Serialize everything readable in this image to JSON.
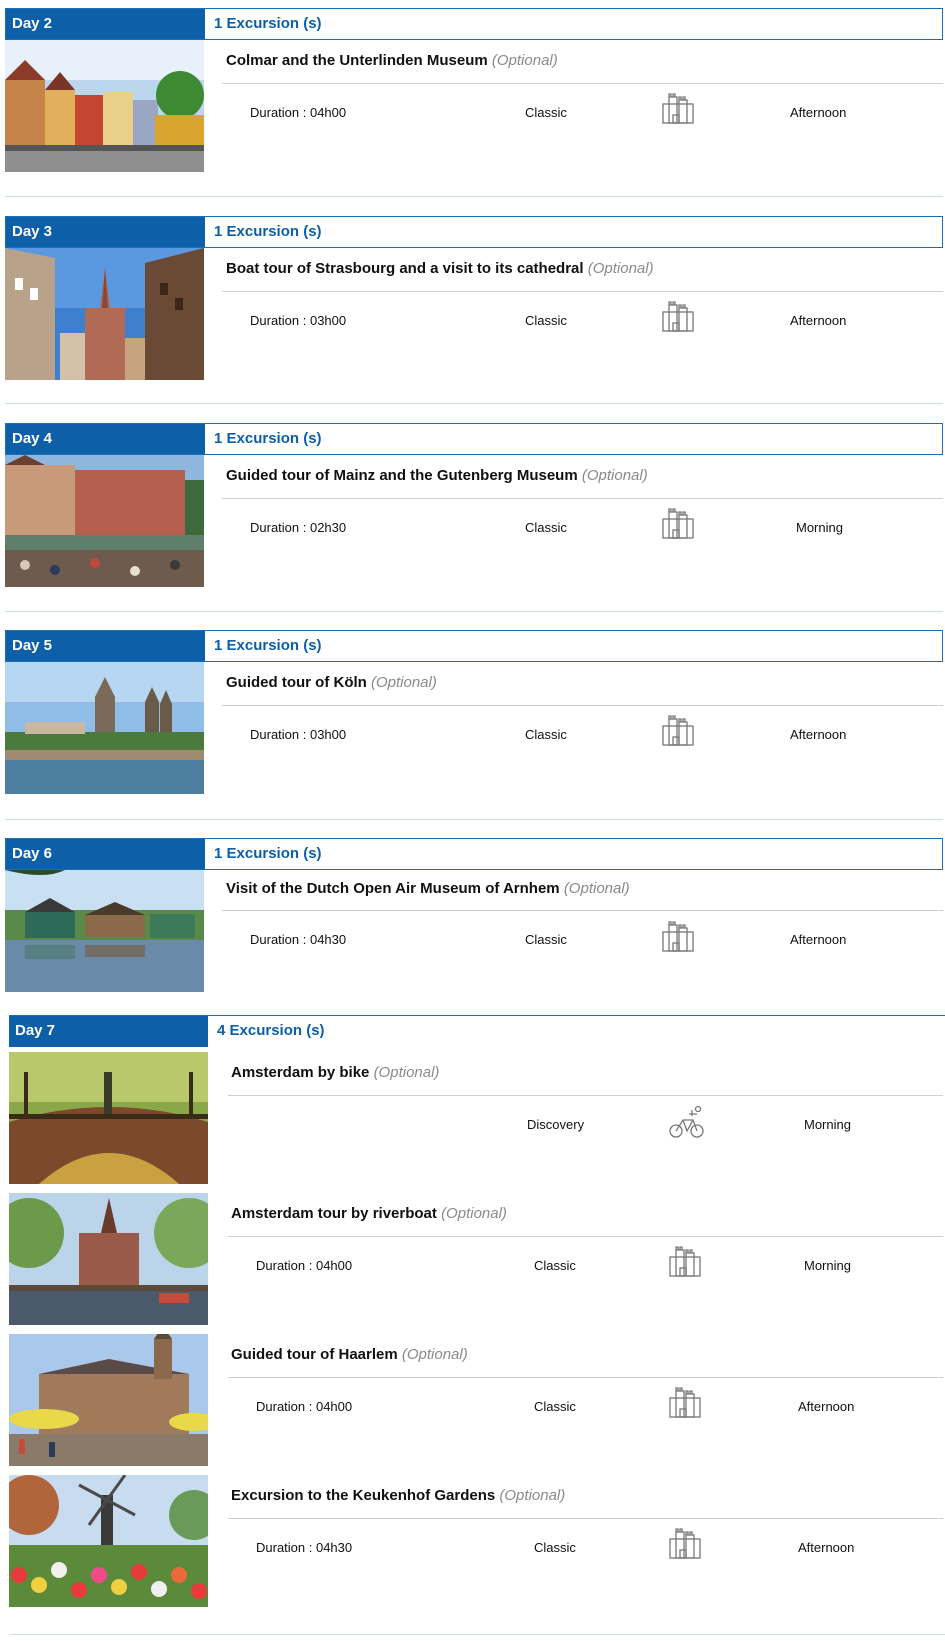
{
  "days": [
    {
      "label": "Day 2",
      "count": "1 Excursion (s)",
      "excursions": [
        {
          "title": "Colmar and the Unterlinden Museum",
          "optional": "(Optional)",
          "duration": "Duration : 04h00",
          "type": "Classic",
          "icon": "castle-icon",
          "time": "Afternoon",
          "photo": "colmar"
        }
      ]
    },
    {
      "label": "Day 3",
      "count": "1 Excursion (s)",
      "excursions": [
        {
          "title": "Boat tour of Strasbourg and a visit to its cathedral",
          "optional": "(Optional)",
          "duration": "Duration : 03h00",
          "type": "Classic",
          "icon": "castle-icon",
          "time": "Afternoon",
          "photo": "strasbourg"
        }
      ]
    },
    {
      "label": "Day 4",
      "count": "1 Excursion (s)",
      "excursions": [
        {
          "title": "Guided tour of Mainz and the Gutenberg Museum",
          "optional": "(Optional)",
          "duration": "Duration : 02h30",
          "type": "Classic",
          "icon": "castle-icon",
          "time": "Morning",
          "photo": "mainz"
        }
      ]
    },
    {
      "label": "Day 5",
      "count": "1 Excursion (s)",
      "excursions": [
        {
          "title": "Guided tour of Köln",
          "optional": "(Optional)",
          "duration": "Duration : 03h00",
          "type": "Classic",
          "icon": "castle-icon",
          "time": "Afternoon",
          "photo": "koln"
        }
      ]
    },
    {
      "label": "Day 6",
      "count": "1 Excursion (s)",
      "excursions": [
        {
          "title": "Visit of the Dutch Open Air Museum of Arnhem",
          "optional": "(Optional)",
          "duration": "Duration : 04h30",
          "type": "Classic",
          "icon": "castle-icon",
          "time": "Afternoon",
          "photo": "arnhem"
        }
      ]
    },
    {
      "label": "Day 7",
      "count": "4 Excursion (s)",
      "excursions": [
        {
          "title": "Amsterdam by bike",
          "optional": "(Optional)",
          "duration": "",
          "type": "Discovery",
          "icon": "bike-icon",
          "time": "Morning",
          "photo": "bridge"
        },
        {
          "title": "Amsterdam tour by riverboat",
          "optional": "(Optional)",
          "duration": "Duration : 04h00",
          "type": "Classic",
          "icon": "castle-icon",
          "time": "Morning",
          "photo": "canal"
        },
        {
          "title": "Guided tour of Haarlem",
          "optional": "(Optional)",
          "duration": "Duration : 04h00",
          "type": "Classic",
          "icon": "castle-icon",
          "time": "Afternoon",
          "photo": "haarlem"
        },
        {
          "title": "Excursion to the Keukenhof Gardens",
          "optional": "(Optional)",
          "duration": "Duration : 04h30",
          "type": "Classic",
          "icon": "castle-icon",
          "time": "Afternoon",
          "photo": "tulips"
        }
      ]
    }
  ],
  "colors": {
    "header": "#0d5fa8",
    "border": "#1a6fb5",
    "optional": "#8a8a8a"
  }
}
